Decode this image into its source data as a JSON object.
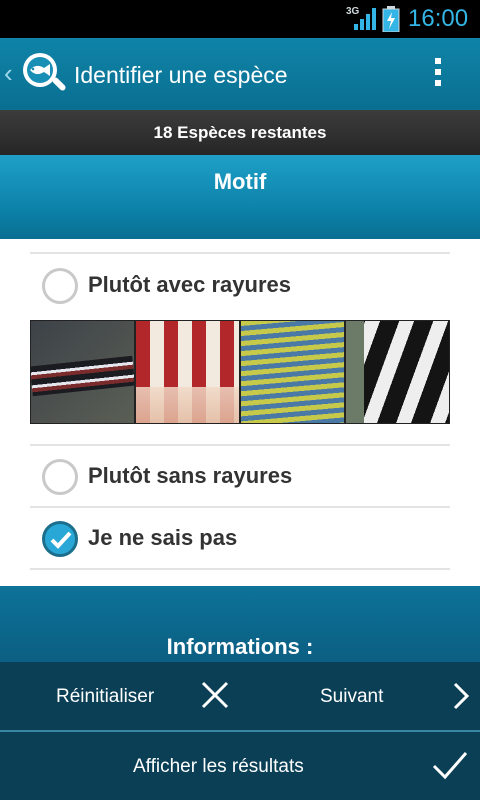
{
  "status": {
    "network": "3G",
    "time": "16:00"
  },
  "actionbar": {
    "back_icon": "back-chevron-icon",
    "logo_icon": "fish-magnifier-icon",
    "title": "Identifier une espèce",
    "menu_icon": "overflow-menu-icon"
  },
  "remaining": {
    "text": "18 Espèces restantes"
  },
  "section": {
    "title": "Motif"
  },
  "options": [
    {
      "label": "Plutôt avec rayures",
      "checked": false
    },
    {
      "label": "Plutôt sans rayures",
      "checked": false
    },
    {
      "label": "Je ne sais pas",
      "checked": true
    }
  ],
  "info": {
    "title": "Informations :"
  },
  "bottom": {
    "reset_label": "Réinitialiser",
    "next_label": "Suivant",
    "results_label": "Afficher les résultats"
  },
  "colors": {
    "accent": "#33b5e5",
    "actionbar": "#0f84a8",
    "bottom": "#0a3f55"
  }
}
